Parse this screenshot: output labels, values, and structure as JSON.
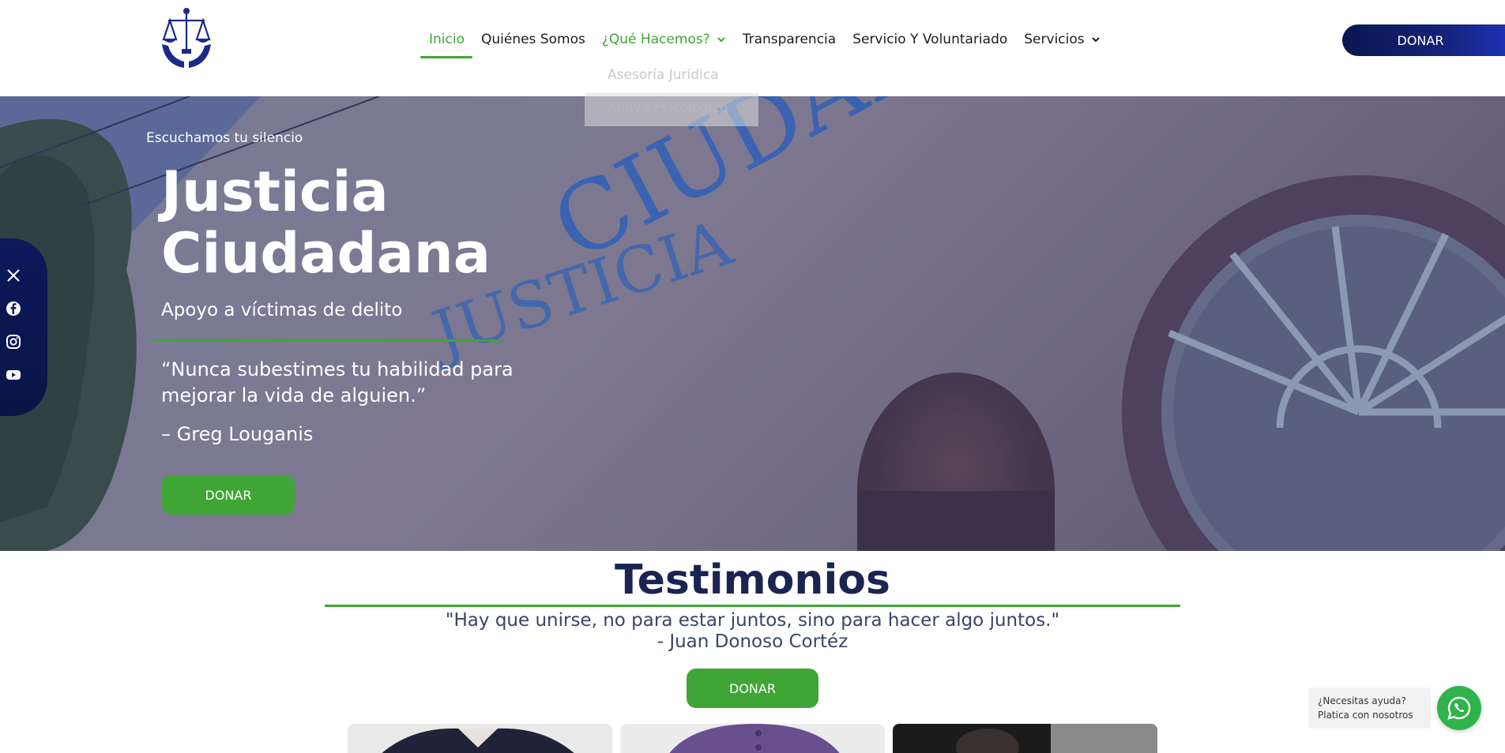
{
  "header": {
    "logo_icon": "scales-of-justice-hands-logo",
    "nav": [
      {
        "label": "Inicio",
        "state": "active"
      },
      {
        "label": "Quiénes Somos",
        "state": "normal"
      },
      {
        "label": "¿Qué Hacemos?",
        "state": "open",
        "has_dropdown": true
      },
      {
        "label": "Transparencia",
        "state": "normal"
      },
      {
        "label": "Servicio Y Voluntariado",
        "state": "normal"
      },
      {
        "label": "Servicios",
        "state": "normal",
        "has_dropdown": true
      }
    ],
    "dropdown_items": [
      "Asesoría Jurídica",
      "Apoyo Psicológico"
    ],
    "donate_label": "DONAR"
  },
  "hero": {
    "kicker": "Escuchamos tu silencio",
    "title_line1": "Justicia",
    "title_line2": "Ciudadana",
    "subtitle": "Apoyo a víctimas de delito",
    "quote": "“Nunca subestimes tu habilidad para mejorar la vida de alguien.”",
    "author": "– Greg Louganis",
    "donate_label": "DONAR",
    "wall_text": "CIUDADA",
    "wall_text2": "JUSTICIA"
  },
  "social": [
    "x-icon",
    "facebook-icon",
    "instagram-icon",
    "youtube-icon"
  ],
  "testimonios": {
    "title": "Testimonios",
    "quote": "\"Hay que unirse, no para estar juntos, sino para hacer algo juntos.\"",
    "author": "- Juan Donoso Cortéz",
    "donate_label": "DONAR"
  },
  "whatsapp": {
    "line1": "¿Necesitas ayuda?",
    "line2": "Platica con nosotros"
  },
  "colors": {
    "brand_green": "#3fa535",
    "brand_navy": "#0b1650",
    "title_navy": "#1a2450"
  }
}
